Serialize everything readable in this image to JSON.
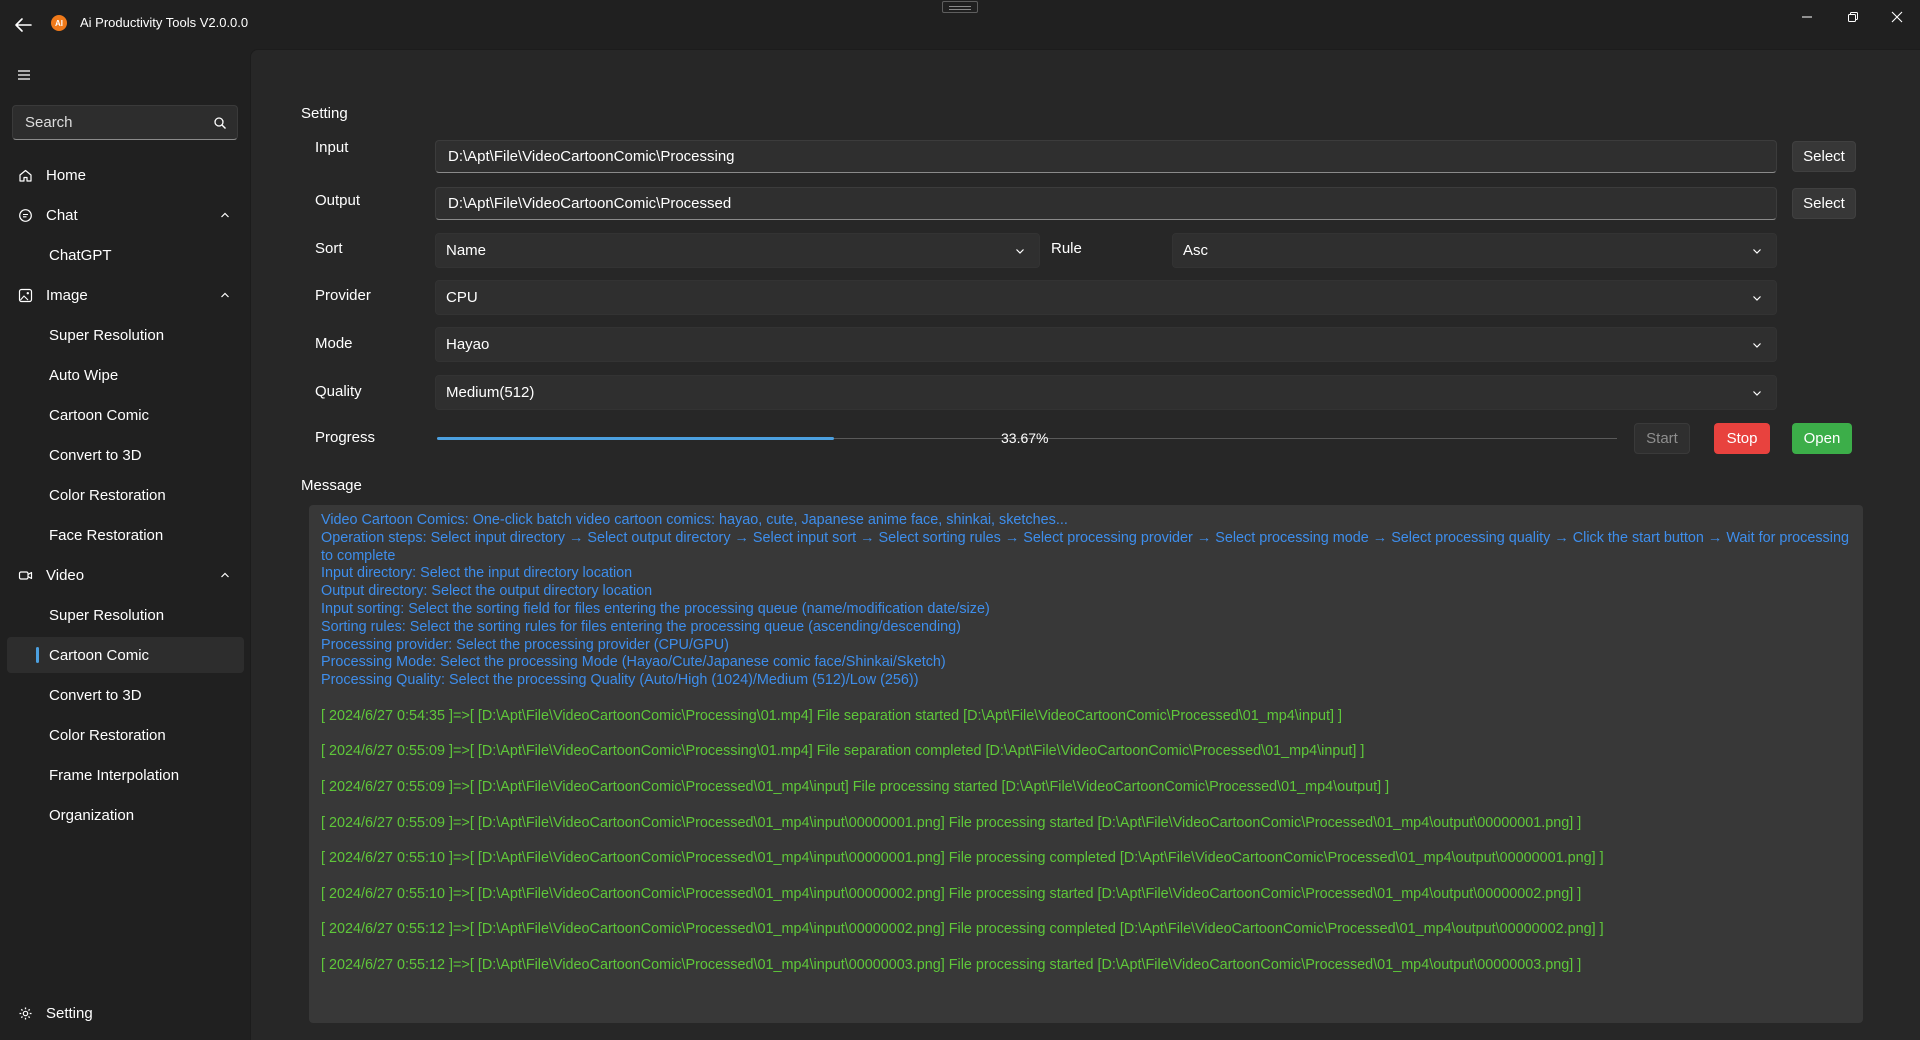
{
  "app": {
    "title": "Ai Productivity Tools V2.0.0.0",
    "logo_text": "AI",
    "accent_color": "#4ca0e0"
  },
  "sidebar": {
    "search_placeholder": "Search",
    "items": [
      {
        "label": "Home",
        "icon": "home-icon",
        "level": "top"
      },
      {
        "label": "Chat",
        "icon": "chat-icon",
        "level": "top",
        "expanded": true
      },
      {
        "label": "ChatGPT",
        "level": "sub"
      },
      {
        "label": "Image",
        "icon": "image-icon",
        "level": "top",
        "expanded": true
      },
      {
        "label": "Super Resolution",
        "level": "sub"
      },
      {
        "label": "Auto Wipe",
        "level": "sub"
      },
      {
        "label": "Cartoon Comic",
        "level": "sub"
      },
      {
        "label": "Convert to 3D",
        "level": "sub"
      },
      {
        "label": "Color Restoration",
        "level": "sub"
      },
      {
        "label": "Face Restoration",
        "level": "sub"
      },
      {
        "label": "Video",
        "icon": "video-icon",
        "level": "top",
        "expanded": true
      },
      {
        "label": "Super Resolution",
        "level": "sub"
      },
      {
        "label": "Cartoon Comic",
        "level": "sub",
        "selected": true
      },
      {
        "label": "Convert to 3D",
        "level": "sub"
      },
      {
        "label": "Color Restoration",
        "level": "sub"
      },
      {
        "label": "Frame Interpolation",
        "level": "sub"
      },
      {
        "label": "Organization",
        "level": "sub"
      }
    ],
    "footer": {
      "label": "Setting",
      "icon": "gear-icon"
    }
  },
  "setting": {
    "section_title": "Setting",
    "input_label": "Input",
    "input_value": "D:\\Apt\\File\\VideoCartoonComic\\Processing",
    "output_label": "Output",
    "output_value": "D:\\Apt\\File\\VideoCartoonComic\\Processed",
    "select_label": "Select",
    "sort_label": "Sort",
    "sort_value": "Name",
    "rule_label": "Rule",
    "rule_value": "Asc",
    "provider_label": "Provider",
    "provider_value": "CPU",
    "mode_label": "Mode",
    "mode_value": "Hayao",
    "quality_label": "Quality",
    "quality_value": "Medium(512)",
    "progress_label": "Progress",
    "progress_text": "33.67%",
    "progress_fraction": 0.3367,
    "start_label": "Start",
    "stop_label": "Stop",
    "open_label": "Open",
    "stop_color": "#e8423e",
    "open_color": "#3cae49"
  },
  "message": {
    "section_title": "Message",
    "info_color": "#3e8eec",
    "log_color": "#5fc73a",
    "info_lines": [
      "Video Cartoon Comics: One-click batch video cartoon comics: hayao, cute, Japanese anime face, shinkai, sketches...",
      "Operation steps: Select input directory → Select output directory → Select input sort → Select sorting rules → Select processing provider → Select processing mode → Select processing quality → Click the start button → Wait for processing to complete",
      "Input directory: Select the input directory location",
      "Output directory: Select the output directory location",
      "Input sorting: Select the sorting field for files entering the processing queue (name/modification date/size)",
      "Sorting rules: Select the sorting rules for files entering the processing queue (ascending/descending)",
      "Processing provider: Select the processing provider (CPU/GPU)",
      "Processing Mode: Select the processing Mode (Hayao/Cute/Japanese comic face/Shinkai/Sketch)",
      "Processing Quality: Select the processing Quality (Auto/High (1024)/Medium (512)/Low (256))"
    ],
    "log_lines": [
      "[ 2024/6/27 0:54:35 ]=>[ [D:\\Apt\\File\\VideoCartoonComic\\Processing\\01.mp4] File separation started [D:\\Apt\\File\\VideoCartoonComic\\Processed\\01_mp4\\input] ]",
      "[ 2024/6/27 0:55:09 ]=>[ [D:\\Apt\\File\\VideoCartoonComic\\Processing\\01.mp4] File separation completed [D:\\Apt\\File\\VideoCartoonComic\\Processed\\01_mp4\\input] ]",
      "[ 2024/6/27 0:55:09 ]=>[ [D:\\Apt\\File\\VideoCartoonComic\\Processed\\01_mp4\\input] File processing started [D:\\Apt\\File\\VideoCartoonComic\\Processed\\01_mp4\\output] ]",
      "[ 2024/6/27 0:55:09 ]=>[ [D:\\Apt\\File\\VideoCartoonComic\\Processed\\01_mp4\\input\\00000001.png] File processing started [D:\\Apt\\File\\VideoCartoonComic\\Processed\\01_mp4\\output\\00000001.png] ]",
      "[ 2024/6/27 0:55:10 ]=>[ [D:\\Apt\\File\\VideoCartoonComic\\Processed\\01_mp4\\input\\00000001.png] File processing completed [D:\\Apt\\File\\VideoCartoonComic\\Processed\\01_mp4\\output\\00000001.png] ]",
      "[ 2024/6/27 0:55:10 ]=>[ [D:\\Apt\\File\\VideoCartoonComic\\Processed\\01_mp4\\input\\00000002.png] File processing started [D:\\Apt\\File\\VideoCartoonComic\\Processed\\01_mp4\\output\\00000002.png] ]",
      "[ 2024/6/27 0:55:12 ]=>[ [D:\\Apt\\File\\VideoCartoonComic\\Processed\\01_mp4\\input\\00000002.png] File processing completed [D:\\Apt\\File\\VideoCartoonComic\\Processed\\01_mp4\\output\\00000002.png] ]",
      "[ 2024/6/27 0:55:12 ]=>[ [D:\\Apt\\File\\VideoCartoonComic\\Processed\\01_mp4\\input\\00000003.png] File processing started [D:\\Apt\\File\\VideoCartoonComic\\Processed\\01_mp4\\output\\00000003.png] ]"
    ]
  }
}
